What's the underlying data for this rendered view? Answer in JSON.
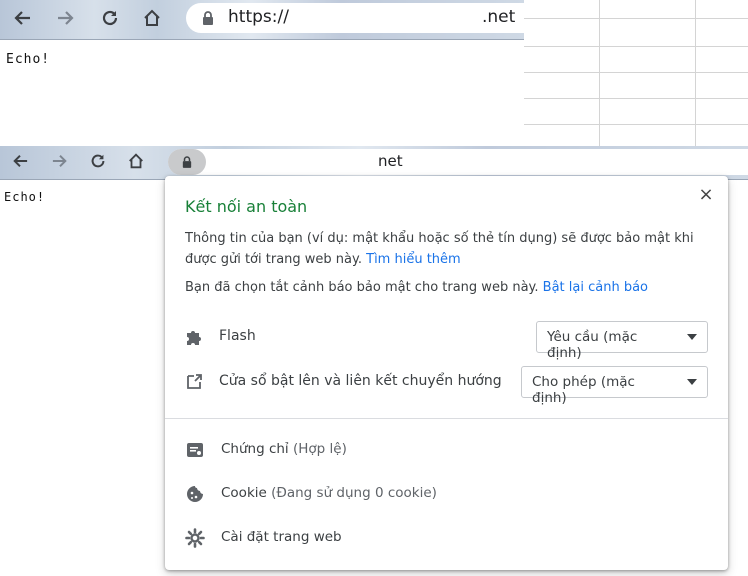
{
  "top_window": {
    "url_prefix": "https://",
    "url_tld": ".net",
    "page_text": "Echo!"
  },
  "bottom_window": {
    "url_tld": "net",
    "page_text": "Echo!"
  },
  "popup": {
    "title": "Kết nối an toàn",
    "close_label": "×",
    "info_text": "Thông tin của bạn (ví dụ: mật khẩu hoặc số thẻ tín dụng) sẽ được bảo mật khi được gửi tới trang web này.",
    "learn_more": "Tìm hiểu thêm",
    "warning_text": "Bạn đã chọn tắt cảnh báo bảo mật cho trang web này.",
    "reenable_link": "Bật lại cảnh báo",
    "permissions": [
      {
        "label": "Flash",
        "value": "Yêu cầu (mặc định)",
        "icon": "puzzle-icon"
      },
      {
        "label": "Cửa sổ bật lên và liên kết chuyển hướng",
        "value": "Cho phép (mặc định)",
        "icon": "popup-redirect-icon"
      }
    ],
    "items": [
      {
        "label": "Chứng chỉ",
        "sub": "(Hợp lệ)",
        "icon": "certificate-icon"
      },
      {
        "label": "Cookie",
        "sub": "(Đang sử dụng 0 cookie)",
        "icon": "cookie-icon"
      },
      {
        "label": "Cài đặt trang web",
        "sub": "",
        "icon": "gear-icon"
      }
    ]
  },
  "colors": {
    "secure_green": "#188038",
    "link_blue": "#1a73e8"
  }
}
